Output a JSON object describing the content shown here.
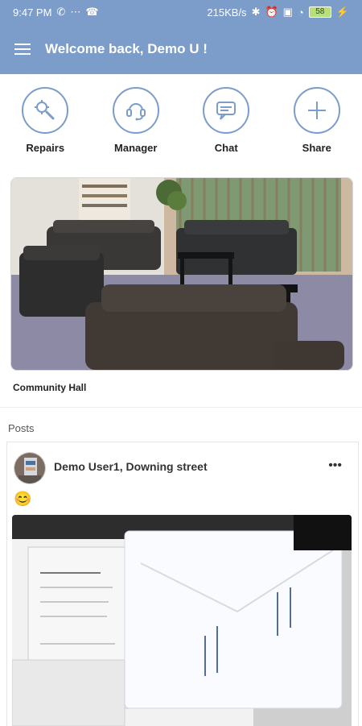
{
  "status": {
    "time": "9:47 PM",
    "speed": "215KB/s",
    "battery": "58"
  },
  "appbar": {
    "title": "Welcome back, Demo U !"
  },
  "actions": [
    {
      "label": "Repairs",
      "icon": "wrench-gear-icon"
    },
    {
      "label": "Manager",
      "icon": "headset-icon"
    },
    {
      "label": "Chat",
      "icon": "chat-bubble-icon"
    },
    {
      "label": "Share",
      "icon": "plus-icon"
    }
  ],
  "featured": {
    "title": "Community Hall"
  },
  "posts": {
    "section_label": "Posts",
    "items": [
      {
        "user": "Demo User1, Downing street",
        "emoji": "😊"
      }
    ]
  },
  "colors": {
    "topbar": "#7c9cc9",
    "accent": "#7c9cc9"
  }
}
